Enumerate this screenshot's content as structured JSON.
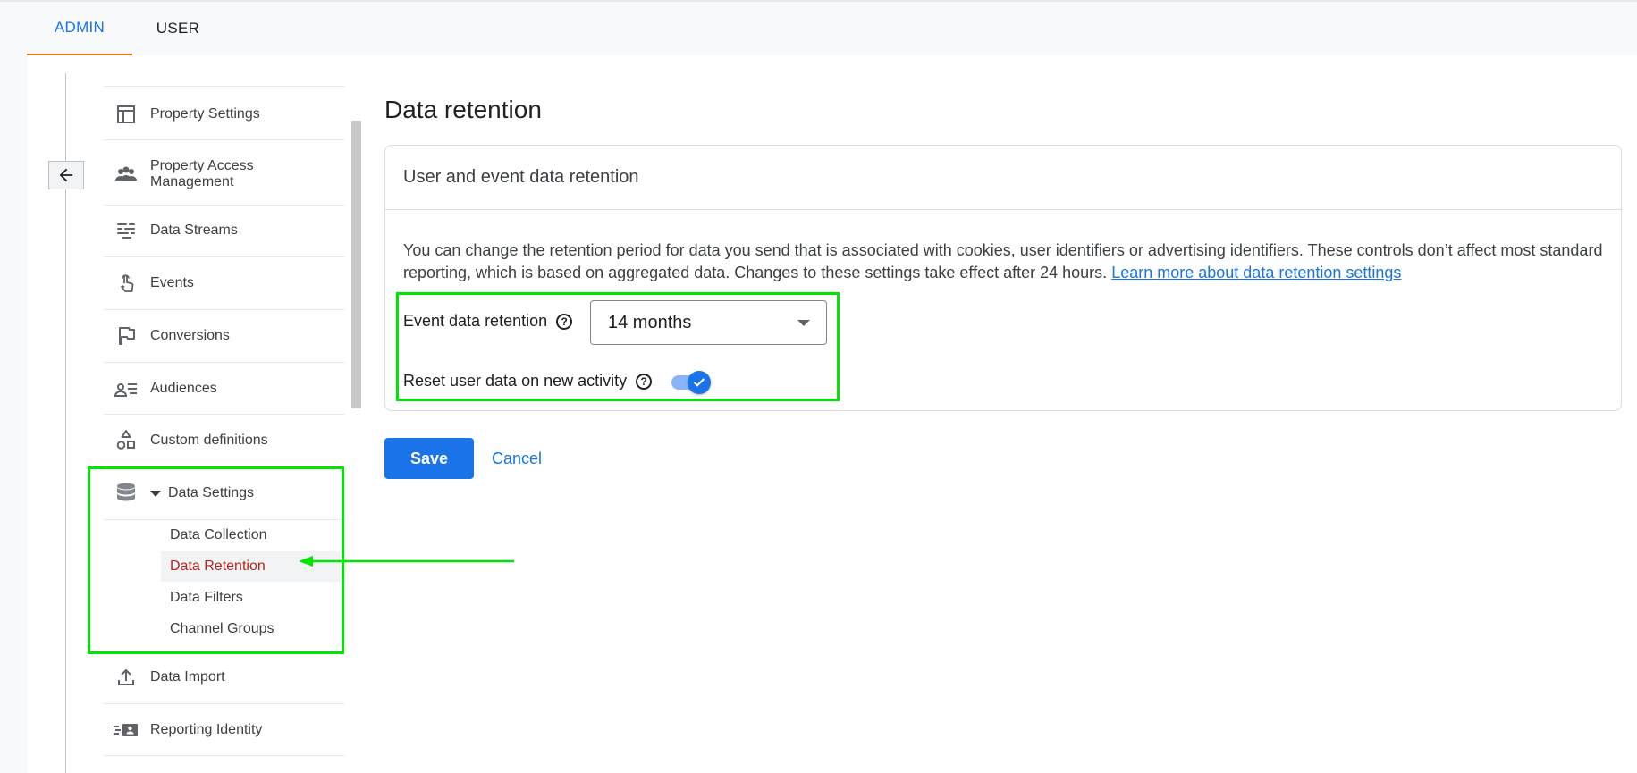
{
  "tabs": [
    {
      "label": "ADMIN",
      "active": true
    },
    {
      "label": "USER",
      "active": false
    }
  ],
  "nav": {
    "items": [
      {
        "label": "Property Settings",
        "icon": "property-settings-icon"
      },
      {
        "label": "Property Access",
        "label2": "Management",
        "icon": "people-icon"
      },
      {
        "label": "Data Streams",
        "icon": "data-streams-icon"
      },
      {
        "label": "Events",
        "icon": "touch-icon"
      },
      {
        "label": "Conversions",
        "icon": "flag-icon"
      },
      {
        "label": "Audiences",
        "icon": "audiences-icon"
      },
      {
        "label": "Custom definitions",
        "icon": "shapes-icon"
      },
      {
        "label": "Data Settings",
        "icon": "database-icon",
        "expanded": true
      },
      {
        "label": "Data Import",
        "icon": "upload-icon"
      },
      {
        "label": "Reporting Identity",
        "icon": "reporting-identity-icon"
      }
    ],
    "sub_items": [
      {
        "label": "Data Collection",
        "active": false
      },
      {
        "label": "Data Retention",
        "active": true
      },
      {
        "label": "Data Filters",
        "active": false
      },
      {
        "label": "Channel Groups",
        "active": false
      }
    ]
  },
  "main": {
    "title": "Data retention",
    "card_title": "User and event data retention",
    "description": "You can change the retention period for data you send that is associated with cookies, user identifiers or advertising identifiers. These controls don’t affect most standard reporting, which is based on aggregated data. Changes to these settings take effect after 24 hours.",
    "learn_more": "Learn more about data retention settings",
    "event_retention_label": "Event data retention",
    "event_retention_value": "14 months",
    "reset_label": "Reset user data on new activity",
    "reset_enabled": true,
    "help_glyph": "?",
    "save_label": "Save",
    "cancel_label": "Cancel"
  },
  "colors": {
    "accent": "#1a73e8",
    "active_tab_underline": "#e37400",
    "active_sub_item": "#b3261e",
    "annotation": "#00e600"
  }
}
